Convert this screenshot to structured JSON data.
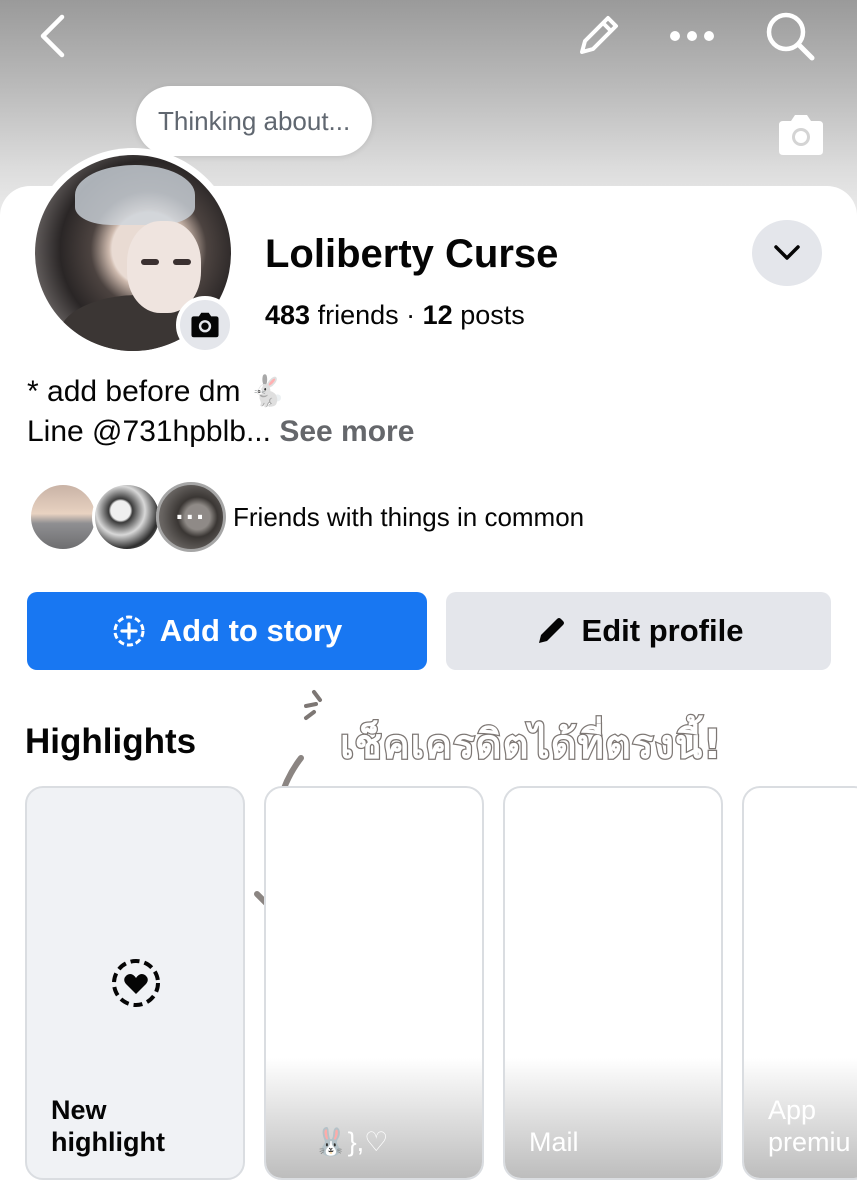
{
  "topbar": {
    "back_icon": "chevron-left-icon",
    "edit_icon": "pencil-icon",
    "more_icon": "ellipsis-icon",
    "search_icon": "search-icon"
  },
  "thought_bubble": {
    "placeholder": "Thinking about..."
  },
  "profile": {
    "name": "Loliberty Curse",
    "friends_count": "483",
    "friends_label": "friends",
    "separator": "·",
    "posts_count": "12",
    "posts_label": "posts",
    "bio_line1": "* add before dm 🐇",
    "bio_line2": "Line @731hpblb...",
    "see_more": "See more"
  },
  "mutuals": {
    "more_glyph": "···",
    "text": "Friends with things in common"
  },
  "actions": {
    "add_story": "Add to story",
    "edit_profile": "Edit profile"
  },
  "highlights": {
    "title": "Highlights",
    "cards": [
      {
        "label": "New\nhighlight"
      },
      {
        "label": "🐰},♡"
      },
      {
        "label": "Mail"
      },
      {
        "label": "App\npremiu"
      }
    ]
  },
  "annotation": {
    "text": "เช็คเครดิตได้ที่ตรงนี้!"
  },
  "colors": {
    "primary": "#1877f2",
    "secondary_btn": "#e4e6eb",
    "muted_text": "#65676b"
  }
}
